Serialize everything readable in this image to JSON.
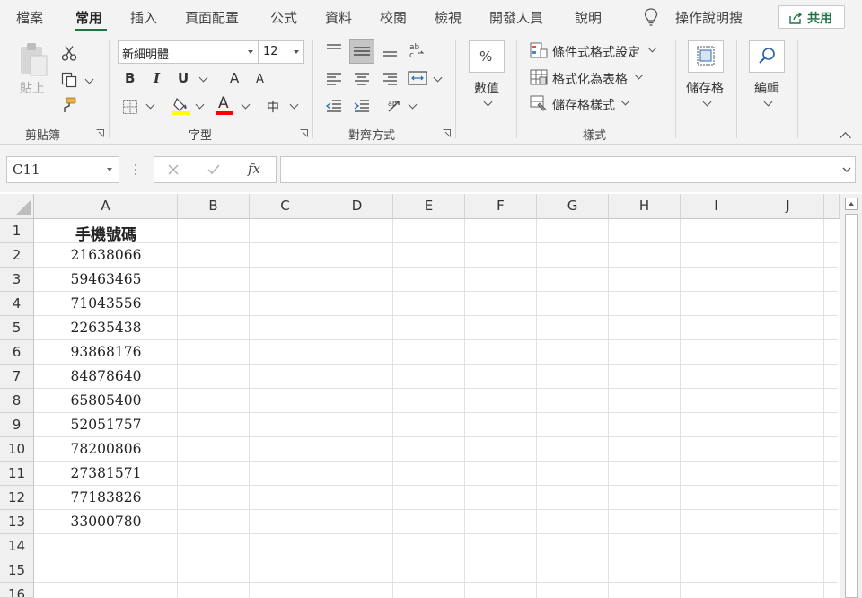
{
  "menu": {
    "tabs": [
      "檔案",
      "常用",
      "插入",
      "頁面配置",
      "公式",
      "資料",
      "校閱",
      "檢視",
      "開發人員",
      "說明"
    ],
    "tellme": "操作說明搜",
    "share": "共用"
  },
  "ribbon": {
    "clipboard": {
      "paste": "貼上",
      "label": "剪貼簿"
    },
    "font": {
      "name": "新細明體",
      "size": "12",
      "bold": "B",
      "italic": "I",
      "underline": "U",
      "grow": "A",
      "shrink": "A",
      "font_color": "A",
      "phonetic": "中",
      "label": "字型"
    },
    "alignment": {
      "label": "對齊方式"
    },
    "number": {
      "icon": "%",
      "label": "數值"
    },
    "styles": {
      "conditional": "條件式格式設定",
      "format_table": "格式化為表格",
      "cell_styles": "儲存格樣式",
      "label": "樣式"
    },
    "cells": {
      "label": "儲存格"
    },
    "editing": {
      "label": "編輯"
    }
  },
  "formula_bar": {
    "name_box": "C11",
    "fx": "fx",
    "value": ""
  },
  "sheet": {
    "columns": [
      "A",
      "B",
      "C",
      "D",
      "E",
      "F",
      "G",
      "H",
      "I",
      "J"
    ],
    "rows": [
      "1",
      "2",
      "3",
      "4",
      "5",
      "6",
      "7",
      "8",
      "9",
      "10",
      "11",
      "12",
      "13",
      "14",
      "15",
      "16"
    ],
    "colA": [
      "手機號碼",
      "21638066",
      "59463465",
      "71043556",
      "22635438",
      "93868176",
      "84878640",
      "65805400",
      "52051757",
      "78200806",
      "27381571",
      "77183826",
      "33000780",
      "",
      "",
      ""
    ]
  },
  "colors": {
    "accent": "#217346",
    "highlight": "#ffff00",
    "font_red": "#ff0000"
  }
}
